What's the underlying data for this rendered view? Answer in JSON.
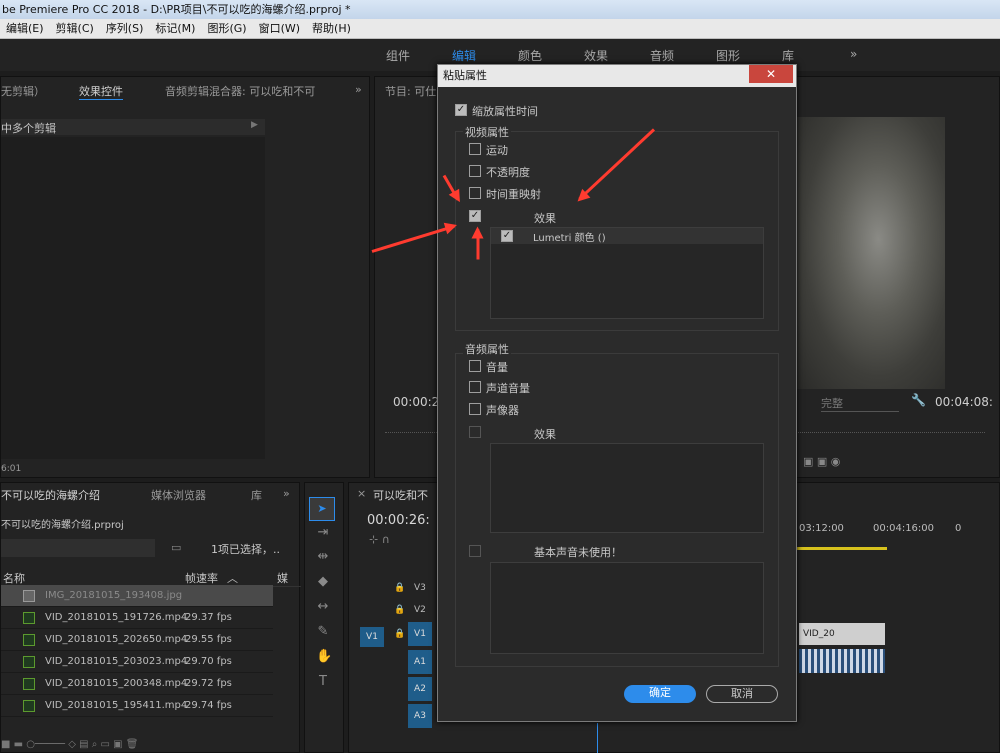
{
  "window": {
    "title": "be Premiere Pro CC 2018 - D:\\PR项目\\不可以吃的海螺介绍.prproj *"
  },
  "menu": [
    "编辑(E)",
    "剪辑(C)",
    "序列(S)",
    "标记(M)",
    "图形(G)",
    "窗口(W)",
    "帮助(H)"
  ],
  "workspaces": [
    "组件",
    "编辑",
    "颜色",
    "效果",
    "音频",
    "图形",
    "库"
  ],
  "workspace_overflow": "»",
  "source_panel": {
    "tabs": [
      "无剪辑）",
      "效果控件",
      "音频剪辑混合器: 可以吃和不可"
    ],
    "placeholder": "中多个剪辑",
    "timecode": "6:01"
  },
  "program_panel": {
    "tab": "节目: 可仕",
    "timecode_left": "00:00:2",
    "quality": "完整",
    "timecode_right": "00:04:08:"
  },
  "project_panel": {
    "tabs": [
      "不可以吃的海螺介绍",
      "媒体浏览器",
      "库"
    ],
    "project_file": "不可以吃的海螺介绍.prproj",
    "selection_info": "1项已选择，..",
    "columns": [
      "名称",
      "帧速率",
      "媒"
    ],
    "items": [
      {
        "name": "IMG_20181015_193408.jpg",
        "fps": "",
        "selected": true
      },
      {
        "name": "VID_20181015_191726.mp4",
        "fps": "29.37 fps"
      },
      {
        "name": "VID_20181015_202650.mp4",
        "fps": "29.55 fps"
      },
      {
        "name": "VID_20181015_203023.mp4",
        "fps": "29.70 fps"
      },
      {
        "name": "VID_20181015_200348.mp4",
        "fps": "29.72 fps"
      },
      {
        "name": "VID_20181015_195411.mp4",
        "fps": "29.74 fps"
      }
    ]
  },
  "timeline": {
    "tab": "可以吃和不",
    "timecode": "00:00:26:",
    "tracks": [
      "V3",
      "V2",
      "V1",
      "A1",
      "A2",
      "A3"
    ],
    "source_patch": "V1",
    "ruler": [
      "03:12:00",
      "00:04:16:00",
      "0"
    ],
    "clip_label": "VID_20"
  },
  "dialog": {
    "title": "粘贴属性",
    "close": "✕",
    "scale_attr": {
      "label": "缩放属性时间",
      "checked": true
    },
    "video_section": "视频属性",
    "video_options": [
      {
        "label": "运动",
        "checked": false
      },
      {
        "label": "不透明度",
        "checked": false
      },
      {
        "label": "时间重映射",
        "checked": false
      },
      {
        "label": "效果",
        "checked": true
      }
    ],
    "effects_list": [
      {
        "label": "Lumetri 颜色 ()",
        "checked": true
      }
    ],
    "audio_section": "音频属性",
    "audio_options": [
      {
        "label": "音量",
        "checked": false
      },
      {
        "label": "声道音量",
        "checked": false
      },
      {
        "label": "声像器",
        "checked": false
      },
      {
        "label": "效果",
        "checked": false
      }
    ],
    "basic_sound": {
      "label": "基本声音未使用！",
      "checked": false
    },
    "ok": "确定",
    "cancel": "取消"
  },
  "colors": {
    "accent": "#2d8ceb",
    "arrow": "#ff3b2f",
    "clip_blue": "#1f5d8a"
  }
}
